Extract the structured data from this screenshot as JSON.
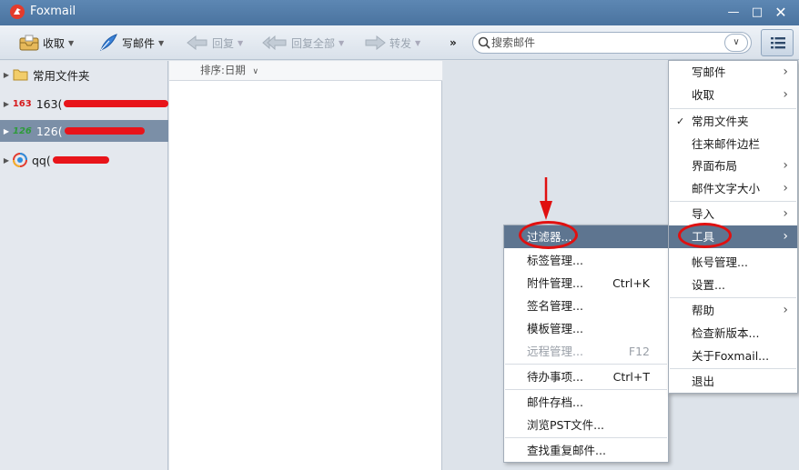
{
  "window": {
    "title": "Foxmail"
  },
  "toolbar": {
    "receive": "收取",
    "compose": "写邮件",
    "reply": "回复",
    "reply_all": "回复全部",
    "forward": "转发",
    "more": "»"
  },
  "search": {
    "placeholder": "搜索邮件"
  },
  "folders": {
    "common": "常用文件夹",
    "accounts": [
      {
        "badge": "163",
        "name": "163("
      },
      {
        "badge": "126",
        "name": "126("
      },
      {
        "name": "qq("
      }
    ]
  },
  "list": {
    "sort_label": "排序:日期"
  },
  "main_menu": {
    "items": [
      {
        "label": "写邮件"
      },
      {
        "label": "收取"
      },
      {
        "label": "常用文件夹"
      },
      {
        "label": "往来邮件边栏"
      },
      {
        "label": "界面布局"
      },
      {
        "label": "邮件文字大小"
      },
      {
        "label": "导入"
      },
      {
        "label": "工具"
      },
      {
        "label": "帐号管理..."
      },
      {
        "label": "设置..."
      },
      {
        "label": "帮助"
      },
      {
        "label": "检查新版本..."
      },
      {
        "label": "关于Foxmail..."
      },
      {
        "label": "退出"
      }
    ]
  },
  "tools_menu": {
    "items": [
      {
        "label": "过滤器..."
      },
      {
        "label": "标签管理..."
      },
      {
        "label": "附件管理...",
        "shortcut": "Ctrl+K"
      },
      {
        "label": "签名管理..."
      },
      {
        "label": "模板管理..."
      },
      {
        "label": "远程管理...",
        "shortcut": "F12"
      },
      {
        "label": "待办事项...",
        "shortcut": "Ctrl+T"
      },
      {
        "label": "邮件存档..."
      },
      {
        "label": "浏览PST文件..."
      },
      {
        "label": "查找重复邮件..."
      }
    ]
  },
  "colors": {
    "titlebar": "#4a739f",
    "highlight": "#5e7590",
    "annotation": "#e01010"
  }
}
